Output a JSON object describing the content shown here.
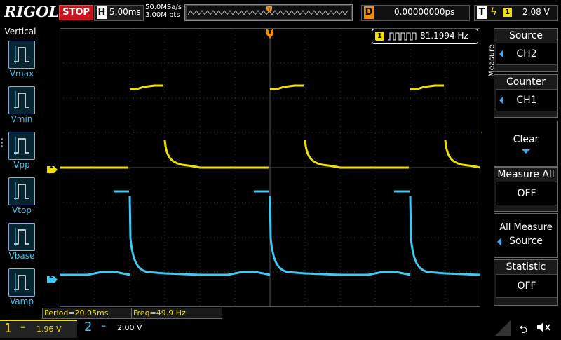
{
  "colors": {
    "ch1": "#f0e000",
    "ch2": "#40c8f0",
    "trigger": "#f08c00",
    "stop": "#c8141e"
  },
  "brand": "RIGOL",
  "run_state": "STOP",
  "timebase": {
    "key": "H",
    "value": "5.00ms"
  },
  "sampling": {
    "rate": "50.0MSa/s",
    "points": "3.00M pts"
  },
  "delay": {
    "key": "D",
    "value": "0.00000000ps"
  },
  "trigger": {
    "key": "T",
    "edge_icon": "rising-edge-icon",
    "source": "1",
    "level": "2.08 V",
    "marker": "T"
  },
  "left_menu": {
    "title": "Vertical",
    "items": [
      {
        "label": "Vmax",
        "icon": "vmax-icon"
      },
      {
        "label": "Vmin",
        "icon": "vmin-icon"
      },
      {
        "label": "Vpp",
        "icon": "vpp-icon"
      },
      {
        "label": "Vtop",
        "icon": "vtop-icon"
      },
      {
        "label": "Vbase",
        "icon": "vbase-icon"
      },
      {
        "label": "Vamp",
        "icon": "vamp-icon"
      }
    ]
  },
  "right_menu": {
    "title": "Measure",
    "source": {
      "label": "Source",
      "value": "CH2"
    },
    "counter": {
      "label": "Counter",
      "value": "CH1"
    },
    "clear": {
      "label": "Clear"
    },
    "measure_all": {
      "label": "Measure All",
      "value": "OFF"
    },
    "all_measure_source": {
      "line1": "All Measure",
      "line2": "Source"
    },
    "statistic": {
      "label": "Statistic",
      "value": "OFF"
    }
  },
  "measurement": {
    "channel": "1",
    "value": "81.1994 Hz"
  },
  "status": {
    "period": "Period=20.05ms",
    "freq": "Freq=49.9 Hz"
  },
  "channels": [
    {
      "number": "1",
      "scale": "1.96 V",
      "marker": "1"
    },
    {
      "number": "2",
      "scale": "2.00 V",
      "marker": "2"
    }
  ]
}
